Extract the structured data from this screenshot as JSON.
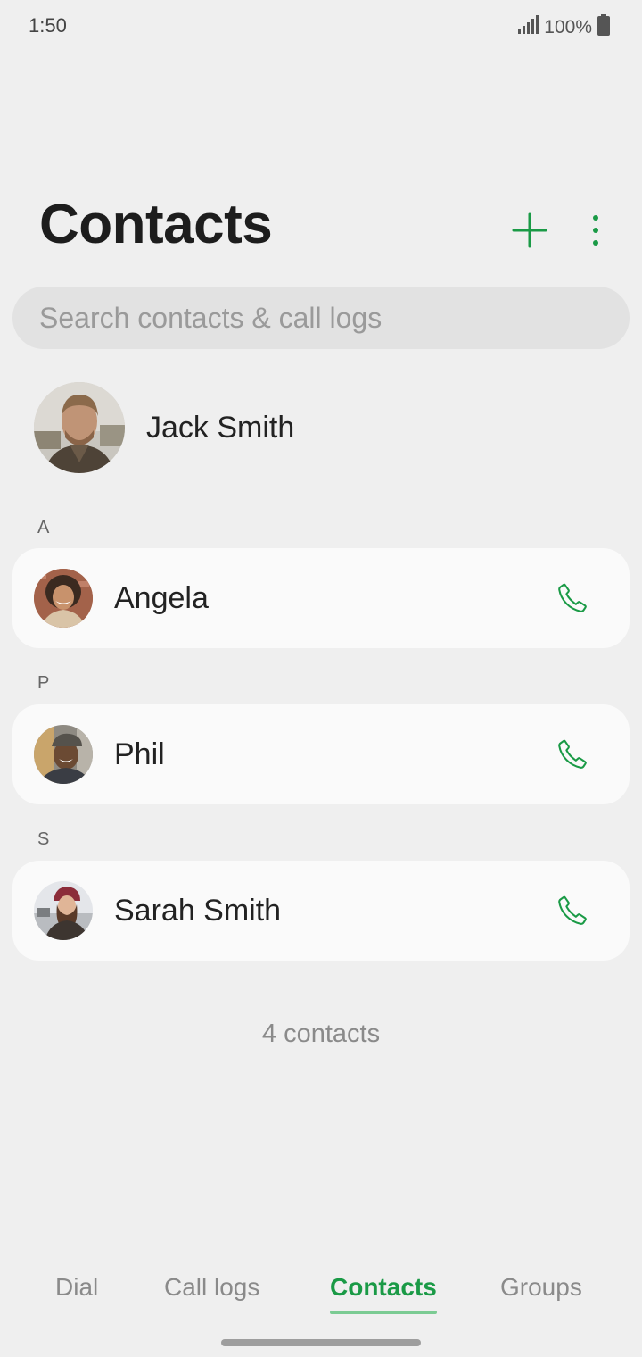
{
  "status_bar": {
    "time": "1:50",
    "battery_text": "100%",
    "signal_icon": "signal-icon",
    "battery_icon": "battery-icon"
  },
  "header": {
    "title": "Contacts",
    "add_icon": "plus-icon",
    "more_icon": "more-vertical-icon"
  },
  "search": {
    "placeholder": "Search contacts & call logs",
    "value": ""
  },
  "profile": {
    "name": "Jack Smith"
  },
  "sections": [
    {
      "letter": "A",
      "contact": {
        "name": "Angela"
      }
    },
    {
      "letter": "P",
      "contact": {
        "name": "Phil"
      }
    },
    {
      "letter": "S",
      "contact": {
        "name": "Sarah Smith"
      }
    }
  ],
  "footer": {
    "count": "4 contacts"
  },
  "tabs": [
    {
      "label": "Dial",
      "active": false
    },
    {
      "label": "Call logs",
      "active": false
    },
    {
      "label": "Contacts",
      "active": true
    },
    {
      "label": "Groups",
      "active": false
    }
  ],
  "colors": {
    "accent": "#1a9a46",
    "background": "#efefef",
    "card": "#fafafa",
    "search_bg": "#e2e2e2"
  }
}
